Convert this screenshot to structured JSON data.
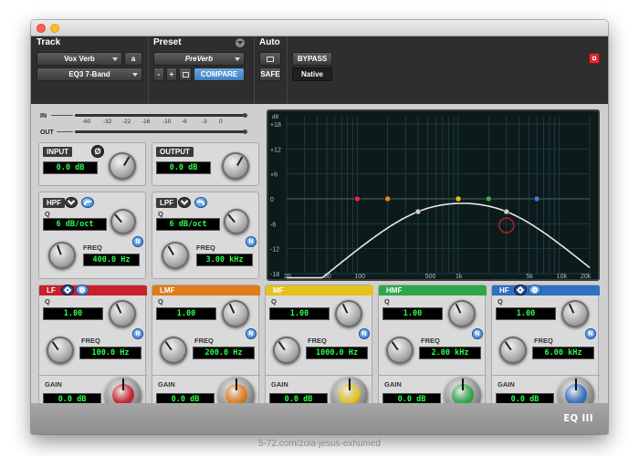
{
  "header": {
    "track_label": "Track",
    "preset_label": "Preset",
    "auto_label": "Auto",
    "track_name": "Vox Verb",
    "track_channel": "a",
    "plugin_name": "EQ3 7-Band",
    "preset_name": "PreVerb",
    "preset_minus": "-",
    "preset_plus": "+",
    "compare": "COMPARE",
    "bypass": "BYPASS",
    "safe": "SAFE",
    "native": "Native"
  },
  "meters": {
    "in_label": "IN",
    "out_label": "OUT",
    "scale": [
      "-60",
      "-32",
      "-22",
      "-16",
      "-10",
      "-6",
      "-3",
      "0"
    ]
  },
  "input": {
    "label": "INPUT",
    "value": "0.0 dB",
    "phase": "Ø"
  },
  "output": {
    "label": "OUTPUT",
    "value": "0.0 dB"
  },
  "hpf": {
    "label": "HPF",
    "q_label": "Q",
    "q_value": "6 dB/oct",
    "freq_label": "FREQ",
    "freq_value": "400.0 Hz",
    "n": "N"
  },
  "lpf": {
    "label": "LPF",
    "q_label": "Q",
    "q_value": "6 dB/oct",
    "freq_label": "FREQ",
    "freq_value": "3.00 kHz",
    "n": "N"
  },
  "bands": [
    {
      "label": "LF",
      "q_label": "Q",
      "q": "1.00",
      "freq_label": "FREQ",
      "freq": "100.0 Hz",
      "gain_label": "GAIN",
      "gain": "0.0 dB",
      "color": "#c8202e",
      "n": "N"
    },
    {
      "label": "LMF",
      "q_label": "Q",
      "q": "1.00",
      "freq_label": "FREQ",
      "freq": "200.0 Hz",
      "gain_label": "GAIN",
      "gain": "0.0 dB",
      "color": "#e07b18",
      "n": "N"
    },
    {
      "label": "MF",
      "q_label": "Q",
      "q": "1.00",
      "freq_label": "FREQ",
      "freq": "1000.0 Hz",
      "gain_label": "GAIN",
      "gain": "0.0 dB",
      "color": "#e6c21c",
      "n": "N"
    },
    {
      "label": "HMF",
      "q_label": "Q",
      "q": "1.00",
      "freq_label": "FREQ",
      "freq": "2.00 kHz",
      "gain_label": "GAIN",
      "gain": "0.0 dB",
      "color": "#2fa64a",
      "n": "N"
    },
    {
      "label": "HF",
      "q_label": "Q",
      "q": "1.00",
      "freq_label": "FREQ",
      "freq": "6.00 kHz",
      "gain_label": "GAIN",
      "gain": "0.0 dB",
      "color": "#2f6fc4",
      "n": "N"
    }
  ],
  "graph": {
    "db_unit": "dB",
    "db_ticks": [
      "+18",
      "+12",
      "+6",
      "0",
      "-6",
      "-12",
      "-18"
    ],
    "freq_ticks": [
      "20",
      "50",
      "100",
      "500",
      "1k",
      "5k",
      "10k",
      "20k"
    ]
  },
  "footer": {
    "logo": "EQ III"
  },
  "caption": "5-72.com/zola-jesus-exhumed"
}
